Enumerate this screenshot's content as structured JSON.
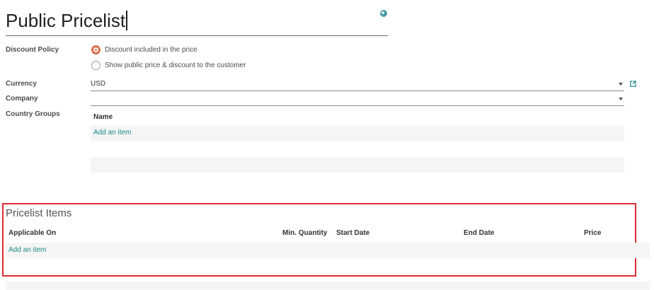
{
  "header": {
    "title": "Public Pricelist"
  },
  "discount_policy": {
    "label": "Discount Policy",
    "options": [
      {
        "label": "Discount included in the price",
        "selected": true
      },
      {
        "label": "Show public price & discount to the customer",
        "selected": false
      }
    ]
  },
  "currency": {
    "label": "Currency",
    "value": "USD"
  },
  "company": {
    "label": "Company",
    "value": ""
  },
  "country_groups": {
    "label": "Country Groups",
    "column": "Name",
    "add_item": "Add an item"
  },
  "pricelist_items": {
    "title": "Pricelist Items",
    "columns": [
      "Applicable On",
      "Min. Quantity",
      "Start Date",
      "End Date",
      "Price"
    ],
    "add_item": "Add an item"
  },
  "colors": {
    "accent": "#d9704b",
    "link": "#1a8a86",
    "highlight_border": "#e02b35"
  }
}
